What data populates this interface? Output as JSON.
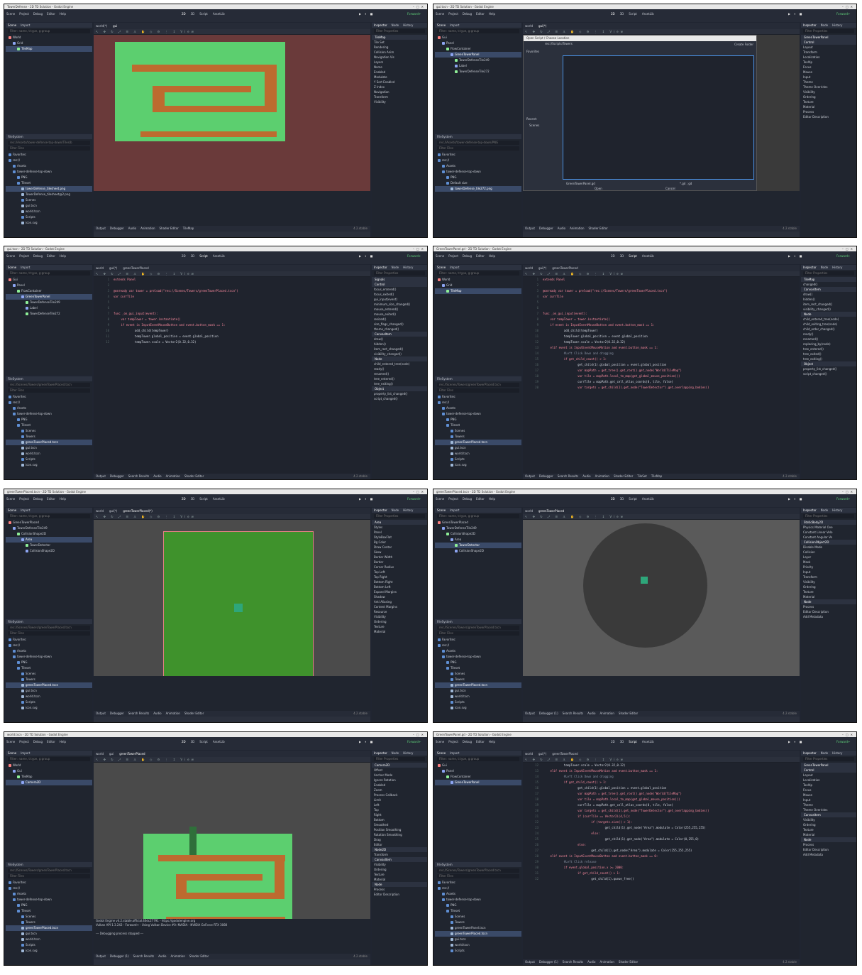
{
  "panels": [
    {
      "title": "TowerDefense - 2D TD Solution - Godot Engine",
      "menus": [
        "Scene",
        "Project",
        "Debug",
        "Editor",
        "Help"
      ],
      "workspaces": [
        "2D",
        "3D",
        "Script",
        "AssetLib"
      ],
      "active_ws": "2D",
      "renderer": "Forward+",
      "scene_tabs": [
        "world(*)",
        "gui"
      ],
      "scene_tree": [
        "World",
        "Grid",
        "TileMap"
      ],
      "sel": "TileMap",
      "filesystem_path": "res://Assets/tower-defense-top-down/Tiles/b",
      "files": [
        "Favorites:",
        "res://",
        "Assets",
        "tower-defense-top-down",
        "PNG",
        "Tileset",
        "towerDefense_tilesheet.png",
        "TowerDefense_tilesheet@2.png",
        "Scenes",
        "gui.tscn",
        "world.tscn",
        "Scripts",
        "icon.svg"
      ],
      "inspector": [
        "TileMap",
        "Tile Set",
        "Rendering",
        "Collision Anim",
        "Navigation Vis",
        "Layers",
        "Name",
        "Enabled",
        "Modulate",
        "Y Sort Enabled",
        "Z Index",
        "Navigation",
        "Transform",
        "Visibility"
      ],
      "bottom_tabs": [
        "Output",
        "Debugger",
        "Audio",
        "Animation",
        "Shader Editor",
        "TileMap"
      ],
      "version": "4.2.stable",
      "kind": "map"
    },
    {
      "title": "gui.tscn - 2D TD Solution - Godot Engine",
      "menus": [
        "Scene",
        "Project",
        "Debug",
        "Editor",
        "Help"
      ],
      "workspaces": [
        "2D",
        "3D",
        "Script",
        "AssetLib"
      ],
      "active_ws": "2D",
      "renderer": "Forward+",
      "scene_tabs": [
        "world",
        "gui(*)"
      ],
      "scene_tree": [
        "Gui",
        "Panel",
        "FlowContainer",
        "GreenTowerPanel",
        "TowerDefenseTile249",
        "Label",
        "TowerDefenseTile272"
      ],
      "sel": "GreenTowerPanel",
      "filesystem_path": "res://Assets/tower-defense-top-down/PNG",
      "files": [
        "Favorites:",
        "res://",
        "Assets",
        "tower-defense-top-down",
        "PNG",
        "Default size",
        "towerDefense_tile272.png"
      ],
      "inspector": [
        "GreenTowerPanel",
        "Control",
        "Layout",
        "Transform",
        "Localization",
        "Tooltip",
        "Focus",
        "Mouse",
        "Input",
        "Theme",
        "Theme Overrides",
        "Visibility",
        "Ordering",
        "Texture",
        "Material",
        "Process",
        "Editor Description"
      ],
      "dialog": {
        "title": "Open Script / Choose Location",
        "path": "res://Scripts/Towers",
        "file": "GreenTowerPanel.gd",
        "filter": "*.gd ; gd",
        "open": "Open",
        "cancel": "Cancel",
        "places": "Favorites",
        "recent": "Recent:",
        "recent_item": "Scenes",
        "create": "Create Folder"
      },
      "bottom_tabs": [
        "Output",
        "Debugger",
        "Audio",
        "Animation",
        "Shader Editor"
      ],
      "version": "4.2.stable",
      "kind": "dialog"
    },
    {
      "title": "gui.tscn - 2D TD Solution - Godot Engine",
      "menus": [
        "Scene",
        "Project",
        "Debug",
        "Editor",
        "Help"
      ],
      "workspaces": [
        "2D",
        "3D",
        "Script",
        "AssetLib"
      ],
      "active_ws": "Script",
      "renderer": "Forward+",
      "scene_tabs": [
        "world",
        "gui(*)",
        "greenTowerPlaced"
      ],
      "scene_tree": [
        "Gui",
        "Panel",
        "FlowContainer",
        "GreenTowerPanel",
        "TowerDefenseTile249",
        "Label",
        "TowerDefenseTile272"
      ],
      "sel": "GreenTowerPanel",
      "filesystem_path": "res://Scenes/Towers/greenTowerPlaced.tscn",
      "files": [
        "Favorites:",
        "res://",
        "Assets",
        "tower-defense-top-down",
        "PNG",
        "Tileset",
        "Scenes",
        "Towers",
        "greenTowerPlaced.tscn",
        "gui.tscn",
        "world.tscn",
        "Scripts",
        "icon.svg"
      ],
      "inspector": [
        "Signals",
        "Control",
        "focus_entered()",
        "focus_exited()",
        "gui_input(event)",
        "minimum_size_changed()",
        "mouse_entered()",
        "mouse_exited()",
        "resized()",
        "size_flags_changed()",
        "theme_changed()",
        "CanvasItem",
        "draw()",
        "hidden()",
        "item_rect_changed()",
        "visibility_changed()",
        "Node",
        "child_entered_tree(node)",
        "ready()",
        "renamed()",
        "tree_entered()",
        "tree_exiting()",
        "Object",
        "property_list_changed()",
        "script_changed()"
      ],
      "code": [
        "extends Panel",
        "",
        "@onready var tower = preload(\"res://Scenes/Towers/greenTowerPlaced.tscn\")",
        "var currTile",
        "",
        "",
        "func _on_gui_input(event):",
        "\tvar tempTower = tower.instantiate()",
        "\tif event is InputEventMouseButton and event.button_mask == 1:",
        "\t\tadd_child(tempTower)",
        "\t\ttempTower.global_position = event.global_position",
        "\t\ttempTower.scale = Vector2(0.32,0.32)"
      ],
      "bottom_tabs": [
        "Output",
        "Debugger",
        "Search Results",
        "Audio",
        "Animation",
        "Shader Editor"
      ],
      "version": "4.2.stable",
      "kind": "code"
    },
    {
      "title": "GreenTowerPanel.gd - 2D TD Solution - Godot Engine",
      "menus": [
        "Scene",
        "Project",
        "Debug",
        "Editor",
        "Help"
      ],
      "workspaces": [
        "2D",
        "3D",
        "Script",
        "AssetLib"
      ],
      "active_ws": "Script",
      "renderer": "Forward+",
      "scene_tabs": [
        "world",
        "gui(*)",
        "greenTowerPlaced"
      ],
      "scene_tree": [
        "World",
        "Grid",
        "TileMap"
      ],
      "sel": "TileMap",
      "filesystem_path": "res://Scenes/Towers/greenTowerPlaced.tscn",
      "files": [
        "Favorites:",
        "res://",
        "Assets",
        "tower-defense-top-down",
        "PNG",
        "Tileset",
        "Scenes",
        "Towers",
        "greenTowerPlaced.tscn",
        "gui.tscn",
        "world.tscn",
        "Scripts",
        "icon.svg"
      ],
      "inspector": [
        "TileMap",
        "changed()",
        "CanvasItem",
        "draw()",
        "hidden()",
        "item_rect_changed()",
        "visibility_changed()",
        "Node",
        "child_entered_tree(node)",
        "child_exiting_tree(node)",
        "child_order_changed()",
        "ready()",
        "renamed()",
        "replacing_by(node)",
        "tree_entered()",
        "tree_exited()",
        "tree_exiting()",
        "Object",
        "property_list_changed()",
        "script_changed()"
      ],
      "code": [
        "extends Panel",
        "",
        "@onready var tower = preload(\"res://Scenes/Towers/greenTowerPlaced.tscn\")",
        "var currTile",
        "",
        "",
        "func _on_gui_input(event):",
        "\tvar tempTower = tower.instantiate()",
        "\tif event is InputEventMouseButton and event.button_mask == 1:",
        "\t\tadd_child(tempTower)",
        "\t\ttempTower.global_position = event.global_position",
        "\t\ttempTower.scale = Vector2(0.32,0.32)",
        "\telif event is InputEventMouseMotion and event.button_mask == 1:",
        "\t\t#Left Click Down and dragging",
        "\t\tif get_child_count() > 1:",
        "\t\t\tget_child(1).global_position = event.global_position",
        "\t\t\tvar mapPath = get_tree().get_root().get_node(\"World/TileMap\")",
        "\t\t\tvar tile = mapPath.local_to_map(get_global_mouse_position())",
        "\t\t\tcurrTile = mapPath.get_cell_atlas_coords(0, tile, false)",
        "\t\t\tvar targets = get_child(1).get_node(\"TowerDetector\").get_overlapping_bodies()"
      ],
      "bottom_tabs": [
        "Output",
        "Debugger",
        "Search Results",
        "Audio",
        "Animation",
        "Shader Editor",
        "TileSet",
        "TileMap"
      ],
      "version": "4.2.stable",
      "kind": "code"
    },
    {
      "title": "greenTowerPlaced.tscn - 2D TD Solution - Godot Engine",
      "menus": [
        "Scene",
        "Project",
        "Debug",
        "Editor",
        "Help"
      ],
      "workspaces": [
        "2D",
        "3D",
        "Script",
        "AssetLib"
      ],
      "active_ws": "2D",
      "renderer": "Forward+",
      "scene_tabs": [
        "world",
        "gui(*)",
        "greenTowerPlaced(*)"
      ],
      "scene_tree": [
        "GreenTowerPlaced",
        "TowerDefenseTile249",
        "CollisionShape2D",
        "Area",
        "TowerDetector",
        "CollisionShape2D"
      ],
      "sel": "Area",
      "filesystem_path": "res://Scenes/Towers/greenTowerPlaced.tscn",
      "files": [
        "Favorites:",
        "res://",
        "Assets",
        "tower-defense-top-down",
        "PNG",
        "Tileset",
        "Scenes",
        "Towers",
        "greenTowerPlaced.tscn",
        "gui.tscn",
        "world.tscn",
        "Scripts",
        "icon.svg"
      ],
      "inspector": [
        "Area",
        "Styles",
        "Panel",
        "StyleBoxFlat",
        "Bg Color",
        "Draw Center",
        "Skew",
        "Border Width",
        "Border",
        "Corner Radius",
        "Top Left",
        "Top Right",
        "Bottom Right",
        "Bottom Left",
        "Expand Margins",
        "Shadow",
        "Anti Aliasing",
        "Content Margins",
        "Resource",
        "Visibility",
        "Ordering",
        "Texture",
        "Material"
      ],
      "bottom_tabs": [
        "Output",
        "Debugger",
        "Search Results",
        "Audio",
        "Animation",
        "Shader Editor"
      ],
      "version": "4.2.stable",
      "kind": "square"
    },
    {
      "title": "greenTowerPlaced.tscn - 2D TD Solution - Godot Engine",
      "menus": [
        "Scene",
        "Project",
        "Debug",
        "Editor",
        "Help"
      ],
      "workspaces": [
        "2D",
        "3D",
        "Script",
        "AssetLib"
      ],
      "active_ws": "2D",
      "renderer": "Forward+",
      "scene_tabs": [
        "world",
        "greenTowerPlaced"
      ],
      "scene_tree": [
        "GreenTowerPlaced",
        "TowerDefenseTile249",
        "CollisionShape2D",
        "Area",
        "TowerDetector",
        "CollisionShape2D"
      ],
      "sel": "TowerDetector",
      "filesystem_path": "res://Scenes/Towers/greenTowerPlaced.tscn",
      "files": [
        "Favorites:",
        "res://",
        "Assets",
        "tower-defense-top-down",
        "PNG",
        "Tileset",
        "Scenes",
        "Towers",
        "greenTowerPlaced.tscn",
        "gui.tscn",
        "world.tscn",
        "Scripts",
        "icon.svg"
      ],
      "inspector": [
        "StaticBody2D",
        "Physics Material Ove",
        "Constant Linear Velo",
        "Constant Angular Ve",
        "CollisionObject2D",
        "Disable Mode",
        "Collision",
        "Layer",
        "Mask",
        "Priority",
        "Input",
        "Transform",
        "Visibility",
        "Ordering",
        "Texture",
        "Material",
        "Node",
        "Process",
        "Editor Description",
        "Add Metadata"
      ],
      "bottom_tabs": [
        "Output",
        "Debugger (1)",
        "Search Results",
        "Audio",
        "Animation",
        "Shader Editor"
      ],
      "version": "4.2.stable",
      "kind": "circle"
    },
    {
      "title": "world.tscn - 2D TD Solution - Godot Engine",
      "menus": [
        "Scene",
        "Project",
        "Debug",
        "Editor",
        "Help"
      ],
      "workspaces": [
        "2D",
        "3D",
        "Script",
        "AssetLib"
      ],
      "active_ws": "2D",
      "renderer": "Forward+",
      "scene_tabs": [
        "world",
        "gui",
        "greenTowerPlaced"
      ],
      "scene_tree": [
        "World",
        "Gui",
        "TileMap",
        "Camera2D"
      ],
      "sel": "Camera2D",
      "filesystem_path": "res://Scenes/Towers/greenTowerPlaced.tscn",
      "files": [
        "Favorites:",
        "res://",
        "Assets",
        "tower-defense-top-down",
        "PNG",
        "Tileset",
        "Scenes",
        "Towers",
        "greenTowerPlaced.tscn",
        "gui.tscn",
        "world.tscn",
        "Scripts",
        "icon.svg"
      ],
      "inspector": [
        "Camera2D",
        "Offset",
        "Anchor Mode",
        "Ignore Rotation",
        "Enabled",
        "Zoom",
        "Process Callback",
        "Limit",
        "Left",
        "Top",
        "Right",
        "Bottom",
        "Smoothed",
        "Position Smoothing",
        "Rotation Smoothing",
        "Drag",
        "Editor",
        "Node2D",
        "Transform",
        "CanvasItem",
        "Visibility",
        "Ordering",
        "Texture",
        "Material",
        "Node",
        "Process",
        "Editor Description"
      ],
      "output": [
        "Godot Engine v4.2.stable.official.46dc27791 - https://godotengine.org",
        "Vulkan API 1.3.242 - Forward+ - Using Vulkan Device #0: NVIDIA - NVIDIA GeForce RTX 3080",
        "",
        "--- Debugging process stopped ---"
      ],
      "bottom_tabs": [
        "Output",
        "Debugger (1)",
        "Search Results",
        "Audio",
        "Animation",
        "Shader Editor"
      ],
      "version": "4.2.stable",
      "kind": "map2"
    },
    {
      "title": "GreenTowerPanel.gd - 2D TD Solution - Godot Engine",
      "menus": [
        "Scene",
        "Project",
        "Debug",
        "Editor",
        "Help"
      ],
      "workspaces": [
        "2D",
        "3D",
        "Script",
        "AssetLib"
      ],
      "active_ws": "Script",
      "renderer": "Forward+",
      "scene_tabs": [
        "world",
        "gui(*)",
        "greenTowerPlaced"
      ],
      "scene_tree": [
        "Gui",
        "Panel",
        "FlowContainer",
        "GreenTowerPanel"
      ],
      "sel": "GreenTowerPanel",
      "filesystem_path": "res://Scenes/Towers/greenTowerPlaced.tscn",
      "files": [
        "Favorites:",
        "res://",
        "Assets",
        "tower-defense-top-down",
        "PNG",
        "Tileset",
        "Scenes",
        "Towers",
        "greenTowerPanel.tscn",
        "greenTowerPlaced.tscn",
        "gui.tscn",
        "world.tscn",
        "Scripts"
      ],
      "inspector": [
        "GreenTowerPanel",
        "Control",
        "Layout",
        "Localization",
        "Tooltip",
        "Focus",
        "Mouse",
        "Input",
        "Theme",
        "Theme Overrides",
        "CanvasItem",
        "Visibility",
        "Ordering",
        "Texture",
        "Material",
        "Node",
        "Process",
        "Editor Description",
        "Add Metadata"
      ],
      "code": [
        "\t\ttempTower.scale = Vector2(0.32,0.32)",
        "\telif event is InputEventMouseMotion and event.button_mask == 1:",
        "\t\t#Left Click Down and dragging",
        "\t\tif get_child_count() > 1:",
        "\t\t\tget_child(1).global_position = event.global_position",
        "\t\t\tvar mapPath = get_tree().get_root().get_node(\"World/TileMap\")",
        "\t\t\tvar tile = mapPath.local_to_map(get_global_mouse_position())",
        "\t\t\tcurrTile = mapPath.get_cell_atlas_coords(0, tile, false)",
        "\t\t\tvar targets = get_child(1).get_node(\"TowerDetector\").get_overlapping_bodies()",
        "\t\t\tif (currTile == Vector2i(4,5)):",
        "\t\t\t\tif (targets.size() > 1):",
        "\t\t\t\t\tget_child(1).get_node(\"Area\").modulate = Color(255,255,255)",
        "\t\t\t\telse:",
        "\t\t\t\t\tget_child(1).get_node(\"Area\").modulate = Color(0,255,0)",
        "\t\t\telse:",
        "\t\t\t\tget_child(1).get_node(\"Area\").modulate = Color(255,255,255)",
        "\telif event is InputEventMouseButton and event.button_mask == 0:",
        "\t\t#Left Click release",
        "\t\tif event.global_position.x >= 2000:",
        "\t\t\tif get_child_count() > 1:",
        "\t\t\t\tget_child(1).queue_free()"
      ],
      "output": [
        "Godot Engine v4.2.stable.official.46dc27791 - https://godotengine.org",
        "Vulkan API 1.3.242 - Forward+ - Using Vulkan Device #0: NVIDIA - NVIDIA GeForce RTX 3080",
        "",
        "--- Debugging process stopped ---"
      ],
      "bottom_tabs": [
        "Output",
        "Debugger (1)",
        "Search Results",
        "Audio",
        "Animation",
        "Shader Editor"
      ],
      "version": "4.2.stable",
      "kind": "code2"
    }
  ]
}
